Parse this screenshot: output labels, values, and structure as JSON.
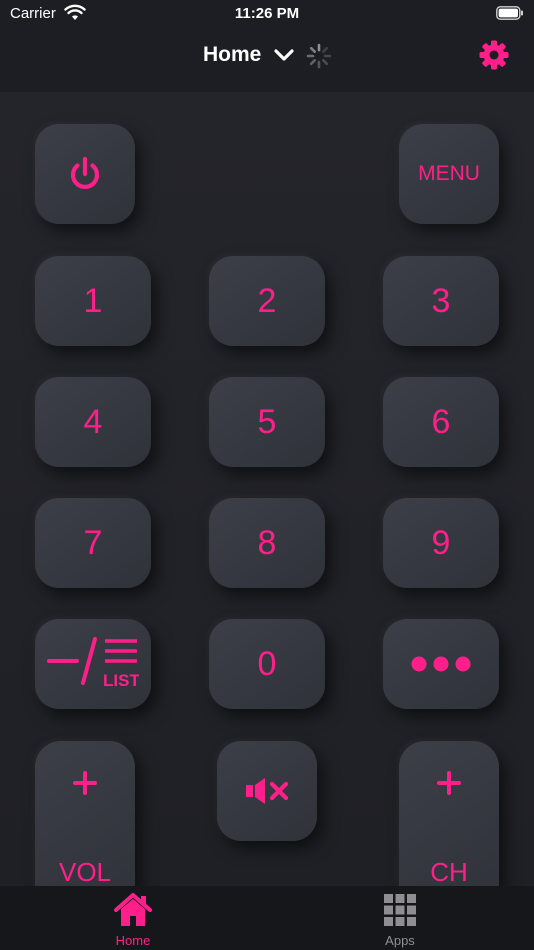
{
  "status_bar": {
    "carrier": "Carrier",
    "time": "11:26 PM"
  },
  "header": {
    "title": "Home"
  },
  "remote": {
    "power_icon": "power-icon",
    "menu_label": "MENU",
    "digits": [
      "1",
      "2",
      "3",
      "4",
      "5",
      "6",
      "7",
      "8",
      "9",
      "0"
    ],
    "list_caption": "LIST",
    "volume_label": "VOL",
    "channel_label": "CH",
    "mute_icon": "mute-icon",
    "more_icon": "more-dots-icon",
    "plus_icon": "plus-icon"
  },
  "tab_bar": {
    "home_label": "Home",
    "apps_label": "Apps"
  },
  "colors": {
    "accent": "#ff1f8a",
    "button_face": "#383a42",
    "background": "#1d1e23",
    "inactive_tab": "#8e8e93"
  }
}
